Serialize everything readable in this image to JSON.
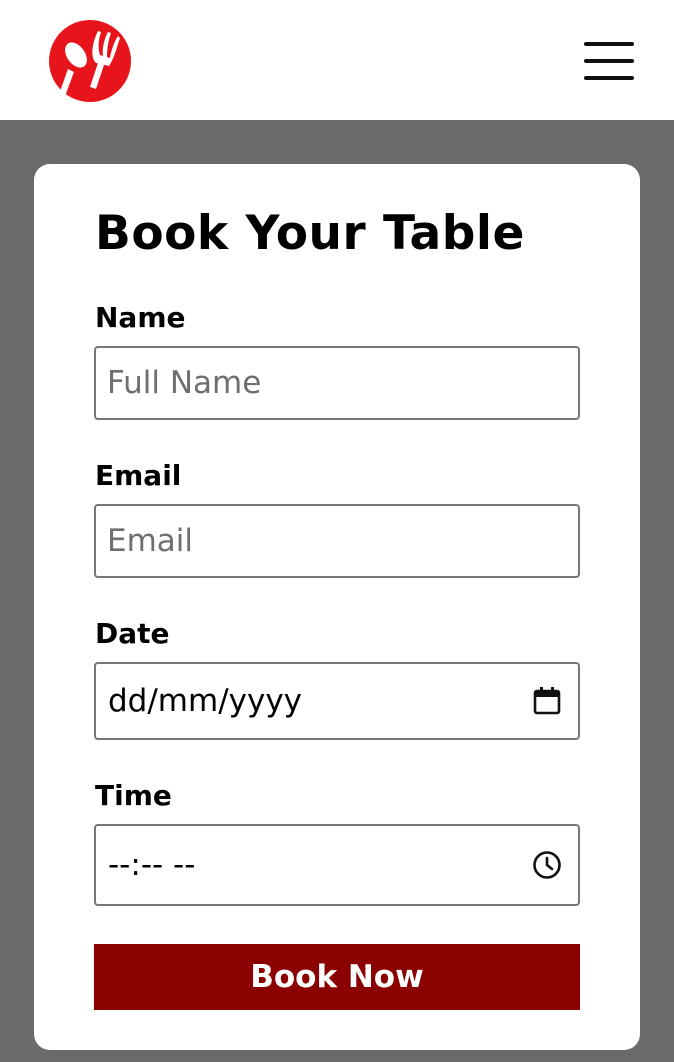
{
  "header": {
    "logo_icon": "fork-and-spoon-logo-icon",
    "brand_color": "#e8141b",
    "menu_icon": "hamburger-menu-icon"
  },
  "form": {
    "title": "Book Your Table",
    "name": {
      "label": "Name",
      "placeholder": "Full Name",
      "value": ""
    },
    "email": {
      "label": "Email",
      "placeholder": "Email",
      "value": ""
    },
    "date": {
      "label": "Date",
      "display": "dd/mm/yyyy",
      "icon": "calendar-icon"
    },
    "time": {
      "label": "Time",
      "display": "--:-- --",
      "icon": "clock-icon"
    },
    "submit_label": "Book Now",
    "submit_color": "#8b0000"
  }
}
